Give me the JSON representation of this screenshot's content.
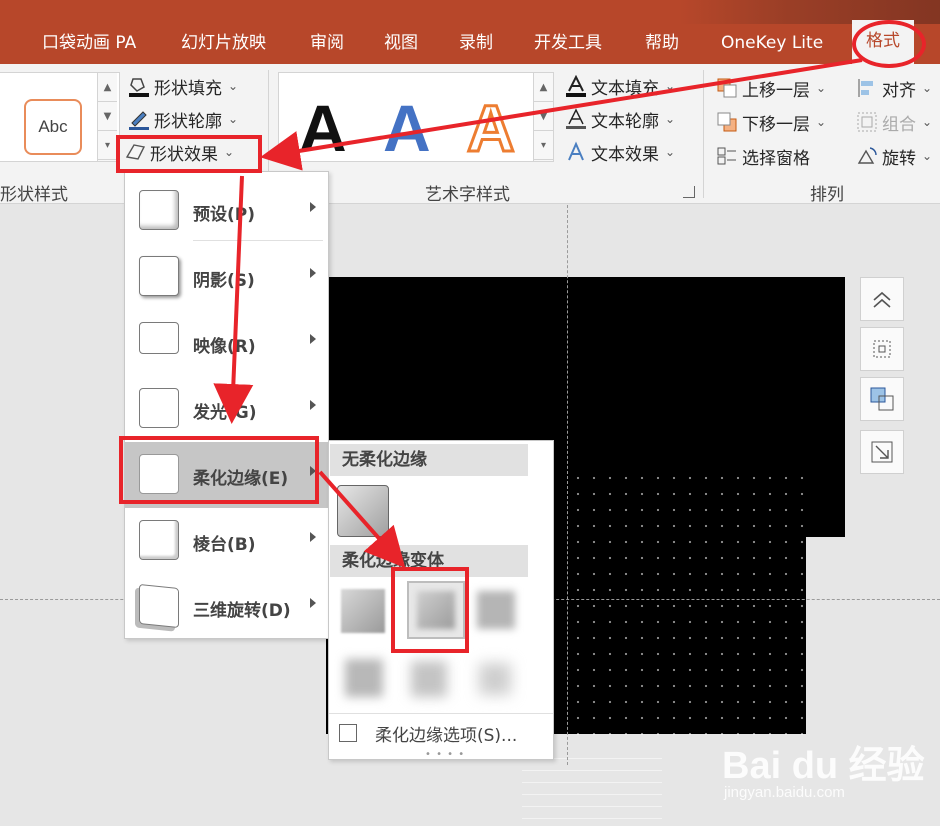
{
  "tabs": [
    {
      "label": "口袋动画 PA"
    },
    {
      "label": "幻灯片放映"
    },
    {
      "label": "审阅"
    },
    {
      "label": "视图"
    },
    {
      "label": "录制"
    },
    {
      "label": "开发工具"
    },
    {
      "label": "帮助"
    },
    {
      "label": "OneKey Lite"
    },
    {
      "label": "格式",
      "active": true
    }
  ],
  "ribbon": {
    "shape_styles": {
      "swatch_text": "Abc",
      "fill": "形状填充",
      "outline": "形状轮廓",
      "effects": "形状效果",
      "group_label": "形状样式"
    },
    "wordart": {
      "sample_letter": "A",
      "text_fill": "文本填充",
      "text_outline": "文本轮廓",
      "text_effects": "文本效果",
      "group_label": "艺术字样式"
    },
    "arrange": {
      "bring_forward": "上移一层",
      "send_backward": "下移一层",
      "selection_pane": "选择窗格",
      "align": "对齐",
      "group": "组合",
      "rotate": "旋转",
      "group_label": "排列"
    }
  },
  "effects_menu": [
    {
      "label": "预设(P)",
      "underline_key": "P"
    },
    {
      "label": "阴影(S)",
      "underline_key": "S"
    },
    {
      "label": "映像(R)",
      "underline_key": "R"
    },
    {
      "label": "发光(G)",
      "underline_key": "G"
    },
    {
      "label": "柔化边缘(E)",
      "underline_key": "E",
      "highlighted": true
    },
    {
      "label": "棱台(B)",
      "underline_key": "B"
    },
    {
      "label": "三维旋转(D)",
      "underline_key": "D"
    }
  ],
  "soft_edges_submenu": {
    "no_soft_edges_header": "无柔化边缘",
    "variations_header": "柔化边缘变体",
    "options_label": "柔化边缘选项(S)..."
  },
  "watermark": {
    "logo": "Bai du 经验",
    "url": "jingyan.baidu.com"
  },
  "colors": {
    "accent": "#b7472a",
    "annotation_red": "#e8242a",
    "menu_highlight": "#c6c6c6"
  }
}
